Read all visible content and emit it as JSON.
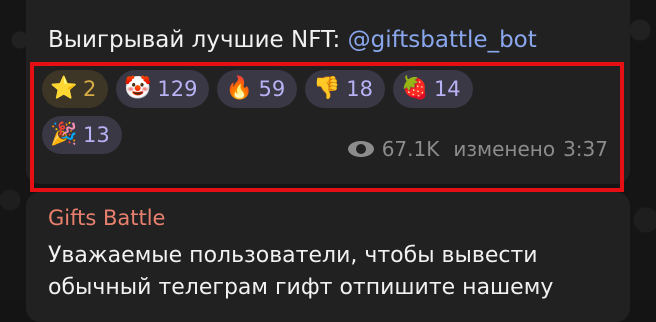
{
  "message": {
    "text_prefix": "Выигрывай лучшие NFT: ",
    "mention": "@giftsbattle_bot",
    "reactions": [
      {
        "emoji": "⭐",
        "icon": "star-icon",
        "count": "2"
      },
      {
        "emoji": "🤡",
        "icon": "clown-icon",
        "count": "129"
      },
      {
        "emoji": "🔥",
        "icon": "fire-icon",
        "count": "59"
      },
      {
        "emoji": "👎",
        "icon": "thumbs-down-icon",
        "count": "18"
      },
      {
        "emoji": "🍓",
        "icon": "strawberry-icon",
        "count": "14"
      },
      {
        "emoji": "🎉",
        "icon": "party-popper-icon",
        "count": "13"
      }
    ],
    "views": "67.1K",
    "edited_label": "изменено",
    "time": "3:37"
  },
  "next_message": {
    "sender": "Gifts Battle",
    "text_line1": "Уважаемые пользователи, чтобы вывести",
    "text_line2": "обычный телеграм гифт отпишите нашему"
  },
  "colors": {
    "highlight": "#e50f14",
    "mention": "#8aa7ee",
    "sender": "#e8806e",
    "reaction_count": "#b8b2f5",
    "star_count": "#d9ac45"
  }
}
